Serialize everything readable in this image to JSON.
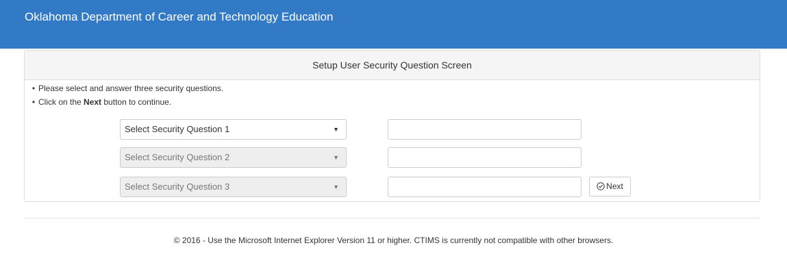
{
  "header": {
    "title": "Oklahoma Department of Career and Technology Education"
  },
  "panel": {
    "heading": "Setup User Security Question Screen",
    "instructions": {
      "line1": "Please select and answer three security questions.",
      "line2_before": "Click on the ",
      "line2_bold": "Next",
      "line2_after": " button to continue."
    },
    "questions": [
      {
        "select_label": "Select Security Question 1",
        "answer_value": "",
        "disabled": false
      },
      {
        "select_label": "Select Security Question 2",
        "answer_value": "",
        "disabled": true
      },
      {
        "select_label": "Select Security Question 3",
        "answer_value": "",
        "disabled": true
      }
    ],
    "next_button_label": "Next"
  },
  "footer": {
    "text": "© 2016 - Use the Microsoft Internet Explorer Version 11 or higher. CTIMS is currently not compatible with other browsers."
  },
  "icons": {
    "dropdown": "caret-down-icon",
    "next": "check-circle-icon"
  },
  "colors": {
    "header_bg": "#337ac6",
    "panel_heading_bg": "#f5f5f5",
    "disabled_bg": "#eeeeee"
  }
}
